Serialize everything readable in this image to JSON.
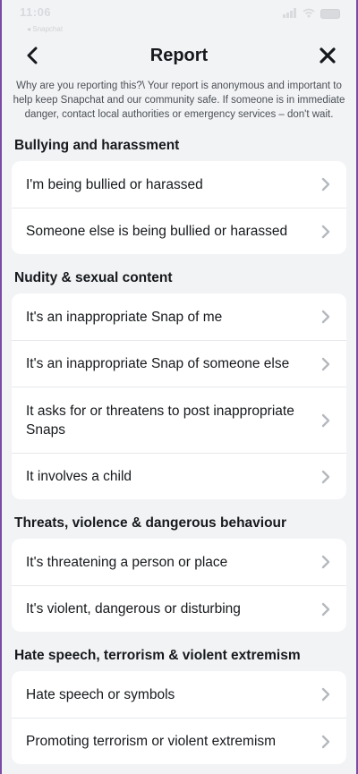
{
  "status": {
    "time": "11:06",
    "sub": "◂ Snapchat"
  },
  "header": {
    "title": "Report",
    "back_icon": "chevron-left-icon",
    "close_icon": "close-icon"
  },
  "intro": "Why are you reporting this?\\ Your report is anonymous and important to help keep Snapchat and our community safe. If someone is in immediate danger, contact local authorities or emergency services – don't wait.",
  "sections": [
    {
      "title": "Bullying and harassment",
      "items": [
        {
          "label": "I'm being bullied or harassed"
        },
        {
          "label": "Someone else is being bullied or harassed"
        }
      ]
    },
    {
      "title": "Nudity & sexual content",
      "items": [
        {
          "label": "It's an inappropriate Snap of me"
        },
        {
          "label": "It's an inappropriate Snap of someone else"
        },
        {
          "label": "It asks for or threatens to post inappropriate Snaps"
        },
        {
          "label": "It involves a child"
        }
      ]
    },
    {
      "title": "Threats, violence & dangerous behaviour",
      "items": [
        {
          "label": "It's threatening a person or place"
        },
        {
          "label": "It's violent, dangerous or disturbing"
        }
      ]
    },
    {
      "title": "Hate speech, terrorism & violent extremism",
      "items": [
        {
          "label": "Hate speech or symbols"
        },
        {
          "label": "Promoting terrorism or violent extremism"
        }
      ]
    }
  ],
  "colors": {
    "background": "#f2f3f5",
    "card": "#ffffff",
    "text": "#16191c",
    "chevron": "#b5b9be",
    "frame": "#7a4aa5"
  }
}
